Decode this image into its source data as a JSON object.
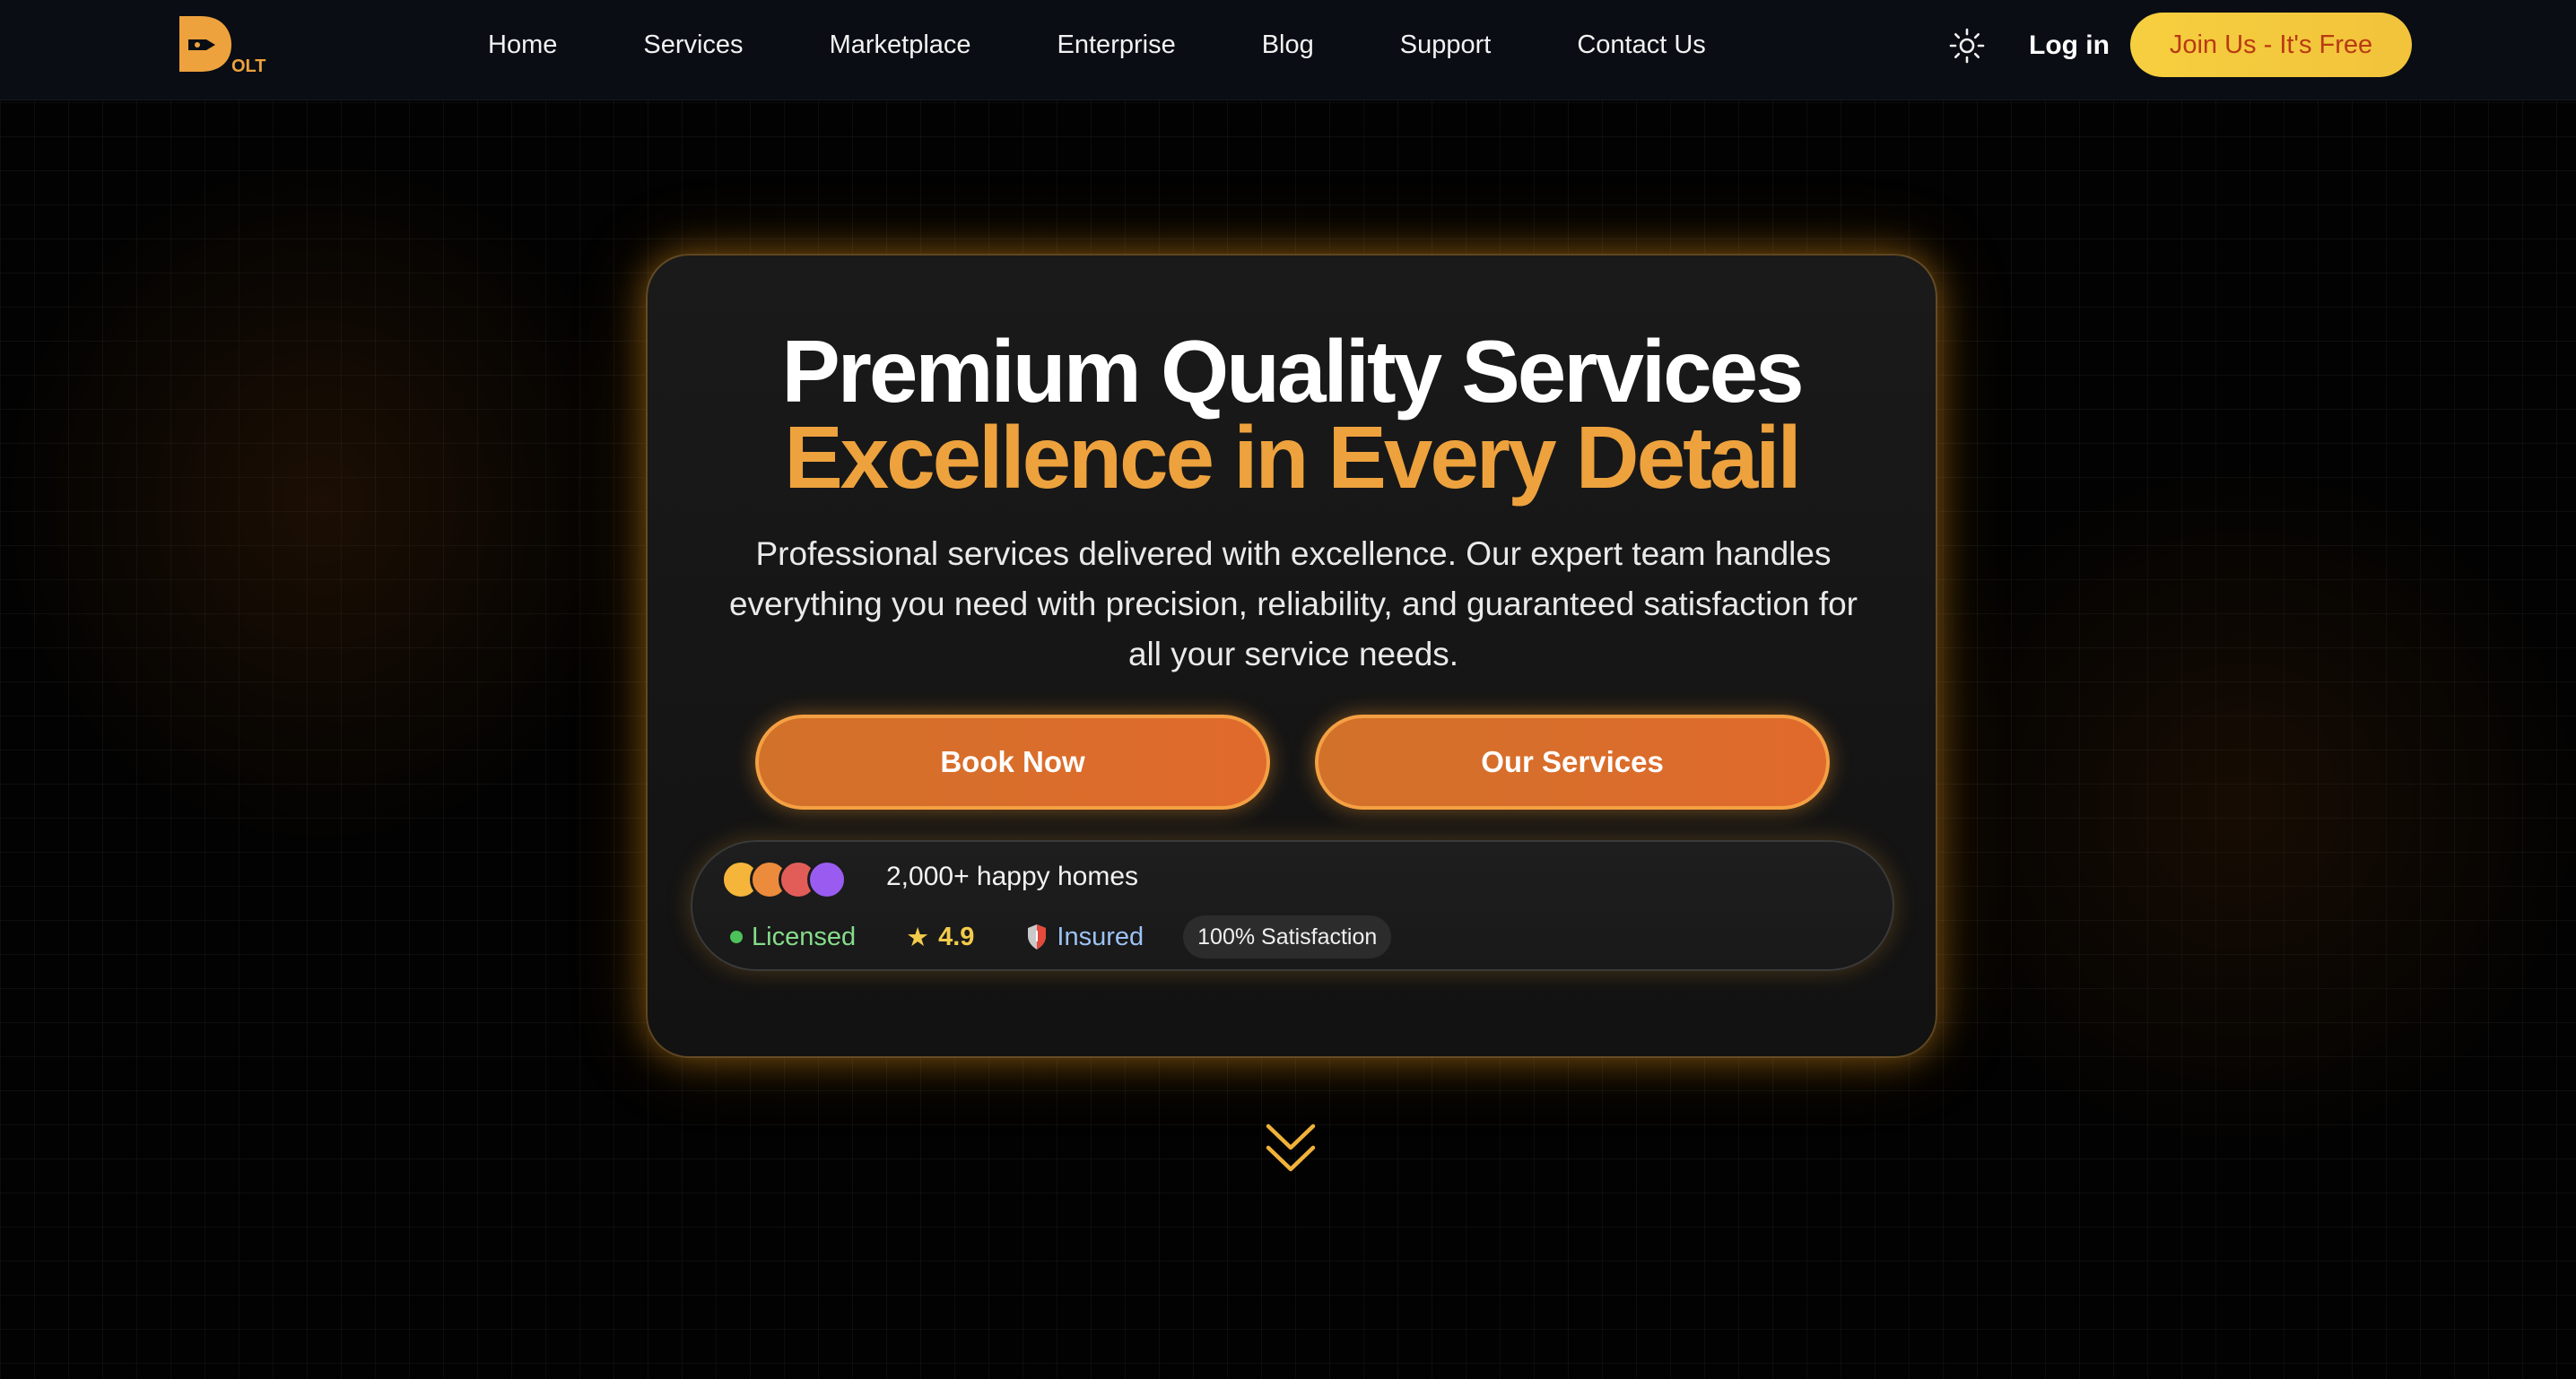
{
  "nav": {
    "logo_text": "DOLT",
    "links": [
      "Home",
      "Services",
      "Marketplace",
      "Enterprise",
      "Blog",
      "Support",
      "Contact Us"
    ],
    "theme_icon": "sun-icon",
    "login_label": "Log in",
    "join_label": "Join Us - It's Free"
  },
  "hero": {
    "title_line1": "Premium Quality Services",
    "title_line2": "Excellence in Every Detail",
    "description": "Professional services delivered with excellence. Our expert team handles everything you need with precision, reliability, and guaranteed satisfaction for all your service needs.",
    "book_label": "Book Now",
    "services_label": "Our Services",
    "social_proof": "2,000+ happy homes",
    "avatar_colors": [
      "#f4b53a",
      "#ec8b3c",
      "#e35d58",
      "#9a5cf0"
    ],
    "badges": {
      "licensed": "Licensed",
      "rating": "4.9",
      "insured": "Insured",
      "satisfaction": "100% Satisfaction"
    }
  },
  "colors": {
    "accent": "#eda23d",
    "join_button": "#f6cf3f",
    "cta_button": "#d8702b"
  },
  "scroll_icon": "double-chevron-down-icon"
}
